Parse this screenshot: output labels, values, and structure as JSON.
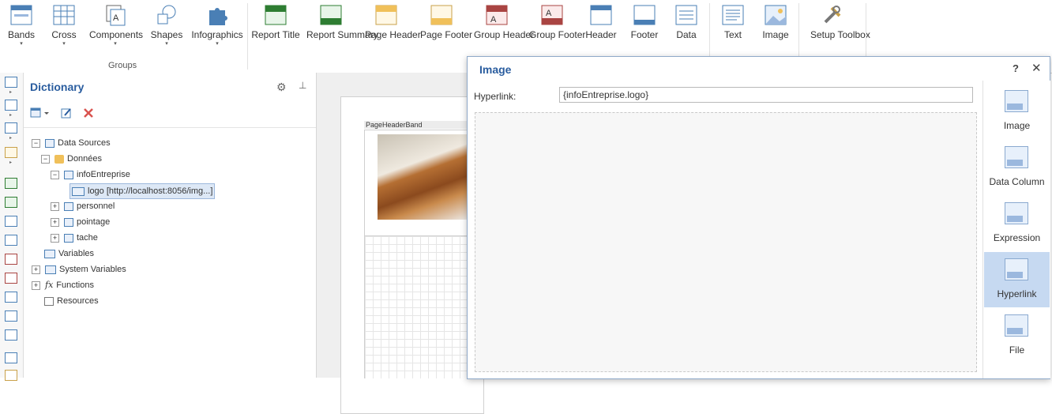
{
  "ribbon": {
    "buttons": [
      {
        "label": "Bands",
        "caret": "▾"
      },
      {
        "label": "Cross",
        "caret": "▾"
      },
      {
        "label": "Components",
        "caret": "▾"
      },
      {
        "label": "Shapes",
        "caret": "▾"
      },
      {
        "label": "Infographics",
        "caret": "▾"
      },
      {
        "label": "Report Title"
      },
      {
        "label": "Report Summary"
      },
      {
        "label": "Page Header"
      },
      {
        "label": "Page Footer"
      },
      {
        "label": "Group Header"
      },
      {
        "label": "Group Footer"
      },
      {
        "label": "Header"
      },
      {
        "label": "Footer"
      },
      {
        "label": "Data"
      },
      {
        "label": "Text"
      },
      {
        "label": "Image"
      },
      {
        "label": "Setup Toolbox"
      }
    ],
    "group_label": "Groups"
  },
  "dictionary": {
    "title": "Dictionary",
    "tree": [
      {
        "label": "Data Sources",
        "expander": "−"
      },
      {
        "label": "Données",
        "expander": "−"
      },
      {
        "label": "infoEntreprise",
        "expander": "−"
      },
      {
        "label": "logo [http://localhost:8056/img...]"
      },
      {
        "label": "personnel",
        "expander": "+"
      },
      {
        "label": "pointage",
        "expander": "+"
      },
      {
        "label": "tache",
        "expander": "+"
      },
      {
        "label": "Variables"
      },
      {
        "label": "System Variables",
        "expander": "+"
      },
      {
        "label": "Functions",
        "expander": "+"
      },
      {
        "label": "Resources"
      }
    ]
  },
  "canvas": {
    "band_label": "PageHeaderBand"
  },
  "dialog": {
    "title": "Image",
    "help": "?",
    "close": "✕",
    "hyperlink_label": "Hyperlink:",
    "hyperlink_value": "{infoEntreprise.logo}",
    "options": [
      {
        "label": "Image"
      },
      {
        "label": "Data Column"
      },
      {
        "label": "Expression"
      },
      {
        "label": "Hyperlink",
        "active": true
      },
      {
        "label": "File"
      }
    ]
  },
  "colors": {
    "accent": "#2a5d9f",
    "active_option": "#c6d9f1"
  }
}
